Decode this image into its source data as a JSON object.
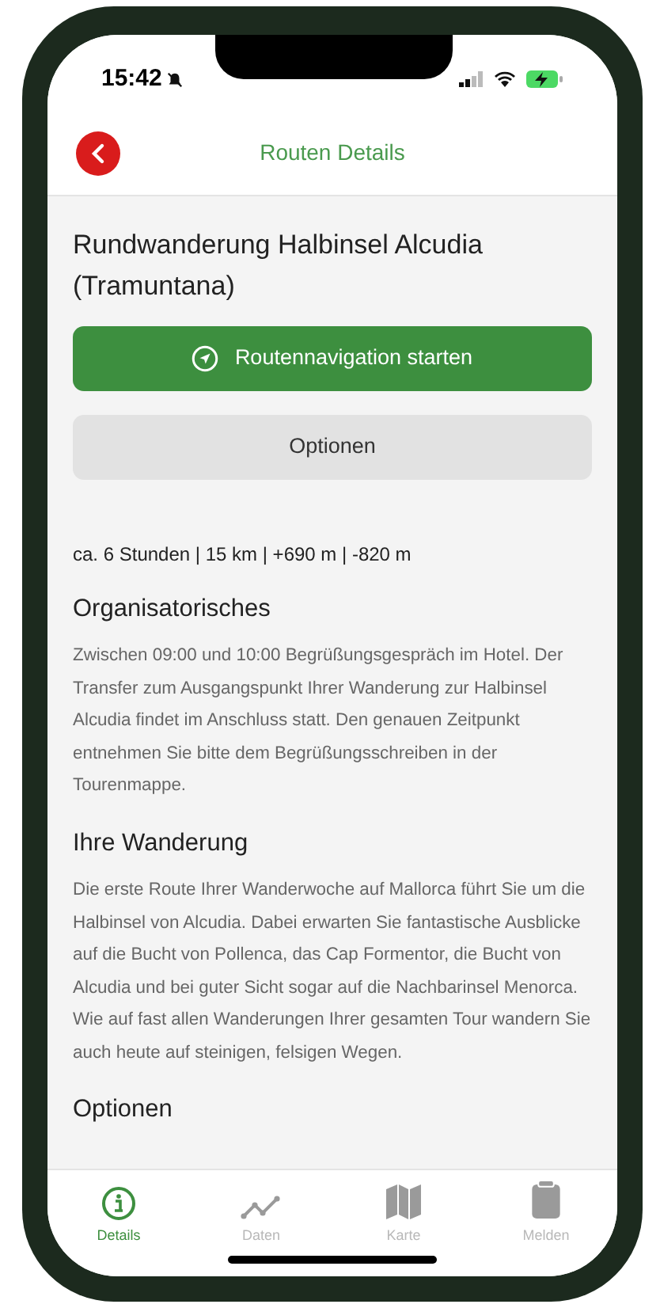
{
  "status_bar": {
    "time": "15:42"
  },
  "header": {
    "title": "Routen Details"
  },
  "route": {
    "title": "Rundwanderung Halbinsel Alcudia (Tramuntana)",
    "primary_button": "Routennavigation starten",
    "secondary_button": "Optionen",
    "stats": "ca. 6 Stunden | 15 km | +690 m | -820 m"
  },
  "sections": [
    {
      "heading": "Organisatorisches",
      "text": "Zwischen 09:00 und 10:00 Begrüßungsgespräch im Hotel. Der Transfer zum Ausgangspunkt Ihrer Wanderung zur Halbinsel Alcudia findet im Anschluss statt. Den genauen Zeitpunkt entnehmen Sie bitte dem Begrüßungsschreiben in der Tourenmappe."
    },
    {
      "heading": "Ihre Wanderung",
      "text": "Die erste Route Ihrer Wanderwoche auf Mallorca führt Sie um die Halbinsel von Alcudia. Dabei erwarten Sie fantastische Ausblicke auf die Bucht von Pollenca, das Cap Formentor, die Bucht von Alcudia und bei guter Sicht sogar auf die Nachbarinsel Menorca. Wie auf fast allen Wanderungen Ihrer gesamten Tour wandern Sie auch heute auf steinigen, felsigen Wegen."
    },
    {
      "heading": "Optionen"
    }
  ],
  "tab_bar": [
    {
      "label": "Details",
      "kind": "info",
      "selected": true
    },
    {
      "label": "Daten",
      "kind": "chart",
      "selected": false
    },
    {
      "label": "Karte",
      "kind": "map",
      "selected": false
    },
    {
      "label": "Melden",
      "kind": "clipboard",
      "selected": false
    }
  ]
}
